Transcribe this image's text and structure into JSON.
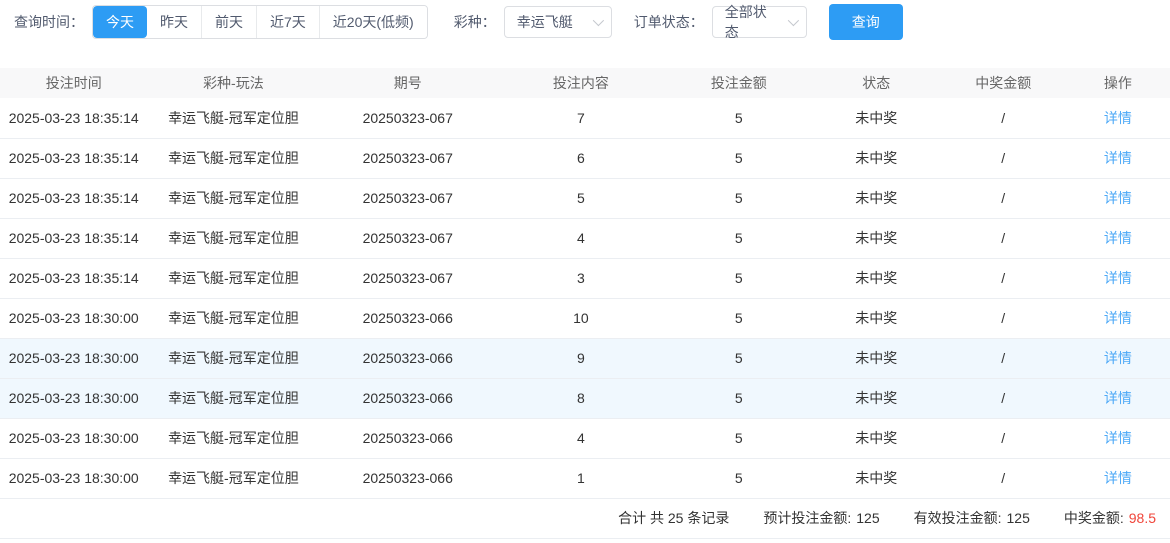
{
  "filter_bar": {
    "time_label": "查询时间：",
    "time_options": [
      {
        "label": "今天",
        "selected": true
      },
      {
        "label": "昨天",
        "selected": false
      },
      {
        "label": "前天",
        "selected": false
      },
      {
        "label": "近7天",
        "selected": false
      },
      {
        "label": "近20天(低频)",
        "selected": false
      }
    ],
    "lottery_label": "彩种：",
    "lottery_value": "幸运飞艇",
    "order_status_label": "订单状态：",
    "order_status_value": "全部状态",
    "search_button": "查询"
  },
  "table": {
    "columns": [
      "投注时间",
      "彩种-玩法",
      "期号",
      "投注内容",
      "投注金额",
      "状态",
      "中奖金额",
      "操作"
    ],
    "action_label": "详情",
    "rows": [
      {
        "time": "2025-03-23 18:35:14",
        "game": "幸运飞艇-冠军定位胆",
        "issue": "20250323-067",
        "content": "7",
        "amount": "5",
        "status": "未中奖",
        "prize": "/",
        "highlight": false
      },
      {
        "time": "2025-03-23 18:35:14",
        "game": "幸运飞艇-冠军定位胆",
        "issue": "20250323-067",
        "content": "6",
        "amount": "5",
        "status": "未中奖",
        "prize": "/",
        "highlight": false
      },
      {
        "time": "2025-03-23 18:35:14",
        "game": "幸运飞艇-冠军定位胆",
        "issue": "20250323-067",
        "content": "5",
        "amount": "5",
        "status": "未中奖",
        "prize": "/",
        "highlight": false
      },
      {
        "time": "2025-03-23 18:35:14",
        "game": "幸运飞艇-冠军定位胆",
        "issue": "20250323-067",
        "content": "4",
        "amount": "5",
        "status": "未中奖",
        "prize": "/",
        "highlight": false
      },
      {
        "time": "2025-03-23 18:35:14",
        "game": "幸运飞艇-冠军定位胆",
        "issue": "20250323-067",
        "content": "3",
        "amount": "5",
        "status": "未中奖",
        "prize": "/",
        "highlight": false
      },
      {
        "time": "2025-03-23 18:30:00",
        "game": "幸运飞艇-冠军定位胆",
        "issue": "20250323-066",
        "content": "10",
        "amount": "5",
        "status": "未中奖",
        "prize": "/",
        "highlight": false
      },
      {
        "time": "2025-03-23 18:30:00",
        "game": "幸运飞艇-冠军定位胆",
        "issue": "20250323-066",
        "content": "9",
        "amount": "5",
        "status": "未中奖",
        "prize": "/",
        "highlight": true
      },
      {
        "time": "2025-03-23 18:30:00",
        "game": "幸运飞艇-冠军定位胆",
        "issue": "20250323-066",
        "content": "8",
        "amount": "5",
        "status": "未中奖",
        "prize": "/",
        "highlight": true
      },
      {
        "time": "2025-03-23 18:30:00",
        "game": "幸运飞艇-冠军定位胆",
        "issue": "20250323-066",
        "content": "4",
        "amount": "5",
        "status": "未中奖",
        "prize": "/",
        "highlight": false
      },
      {
        "time": "2025-03-23 18:30:00",
        "game": "幸运飞艇-冠军定位胆",
        "issue": "20250323-066",
        "content": "1",
        "amount": "5",
        "status": "未中奖",
        "prize": "/",
        "highlight": false
      }
    ]
  },
  "summary": {
    "total_text": "合计 共 25 条记录",
    "expected_label": "预计投注金额:",
    "expected_value": "125",
    "valid_label": "有效投注金额:",
    "valid_value": "125",
    "prize_label": "中奖金额:",
    "prize_value": "98.5"
  },
  "colors": {
    "primary": "#2d9cf4",
    "link": "#4da9f7",
    "prize_red": "#f0453a",
    "row_highlight": "#f0f8fe",
    "header_bg": "#f8f8f9"
  }
}
